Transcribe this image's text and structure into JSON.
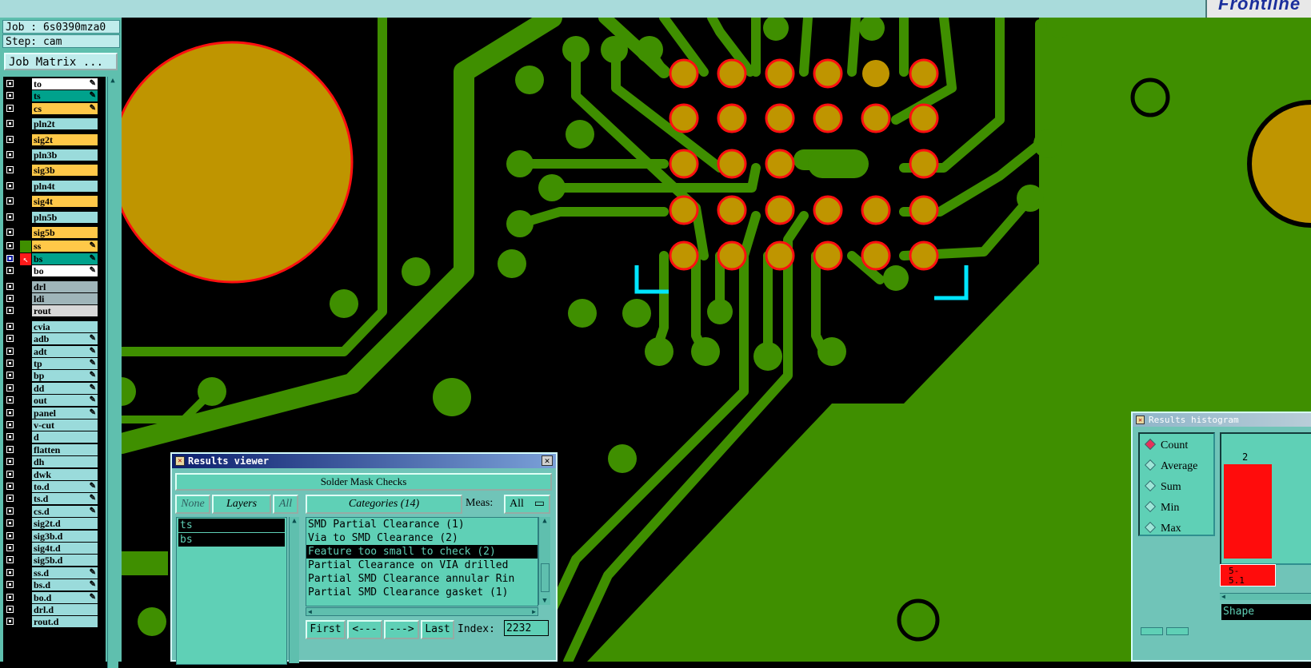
{
  "app": {
    "brand": "Frontline"
  },
  "job": {
    "job_label": "Job : 6s0390mza0",
    "step_label": "Step: cam",
    "matrix_button": "Job Matrix ..."
  },
  "layers": [
    {
      "name": "to",
      "color": "#ffffff",
      "flag": "✎"
    },
    {
      "name": "ts",
      "color": "#00a28c",
      "flag": "✎"
    },
    {
      "name": "cs",
      "color": "#ffc848",
      "flag": "✎"
    },
    {
      "name": "pln2t",
      "color": "#9adbdb",
      "flag": ""
    },
    {
      "name": "sig2t",
      "color": "#ffc848",
      "flag": ""
    },
    {
      "name": "pln3b",
      "color": "#9adbdb",
      "flag": ""
    },
    {
      "name": "sig3b",
      "color": "#ffc848",
      "flag": ""
    },
    {
      "name": "pln4t",
      "color": "#9adbdb",
      "flag": ""
    },
    {
      "name": "sig4t",
      "color": "#ffc848",
      "flag": ""
    },
    {
      "name": "pln5b",
      "color": "#9adbdb",
      "flag": ""
    },
    {
      "name": "sig5b",
      "color": "#ffc848",
      "flag": ""
    },
    {
      "name": "ss",
      "color": "#ffc848",
      "flag": "✎"
    },
    {
      "name": "bs",
      "color": "#00a28c",
      "flag": "✎"
    },
    {
      "name": "bo",
      "color": "#ffffff",
      "flag": "✎"
    },
    {
      "name": "drl",
      "color": "#9fb5b9",
      "flag": ""
    },
    {
      "name": "ldi",
      "color": "#9fb5b9",
      "flag": ""
    },
    {
      "name": "rout",
      "color": "#d8d8d8",
      "flag": ""
    },
    {
      "name": "cvia",
      "color": "#9adbdb",
      "flag": ""
    },
    {
      "name": "adb",
      "color": "#9adbdb",
      "flag": "✎"
    },
    {
      "name": "adt",
      "color": "#9adbdb",
      "flag": "✎"
    },
    {
      "name": "tp",
      "color": "#9adbdb",
      "flag": "✎"
    },
    {
      "name": "bp",
      "color": "#9adbdb",
      "flag": "✎"
    },
    {
      "name": "dd",
      "color": "#9adbdb",
      "flag": "✎"
    },
    {
      "name": "out",
      "color": "#9adbdb",
      "flag": "✎"
    },
    {
      "name": "panel",
      "color": "#9adbdb",
      "flag": "✎"
    },
    {
      "name": "v-cut",
      "color": "#9adbdb",
      "flag": ""
    },
    {
      "name": "d",
      "color": "#9adbdb",
      "flag": ""
    },
    {
      "name": "flatten",
      "color": "#9adbdb",
      "flag": ""
    },
    {
      "name": "dh",
      "color": "#9adbdb",
      "flag": ""
    },
    {
      "name": "dwk",
      "color": "#9adbdb",
      "flag": ""
    },
    {
      "name": "to.d",
      "color": "#9adbdb",
      "flag": "✎"
    },
    {
      "name": "ts.d",
      "color": "#9adbdb",
      "flag": "✎"
    },
    {
      "name": "cs.d",
      "color": "#9adbdb",
      "flag": "✎"
    },
    {
      "name": "sig2t.d",
      "color": "#9adbdb",
      "flag": ""
    },
    {
      "name": "sig3b.d",
      "color": "#9adbdb",
      "flag": ""
    },
    {
      "name": "sig4t.d",
      "color": "#9adbdb",
      "flag": ""
    },
    {
      "name": "sig5b.d",
      "color": "#9adbdb",
      "flag": ""
    },
    {
      "name": "ss.d",
      "color": "#9adbdb",
      "flag": "✎"
    },
    {
      "name": "bs.d",
      "color": "#9adbdb",
      "flag": "✎"
    },
    {
      "name": "bo.d",
      "color": "#9adbdb",
      "flag": "✎"
    },
    {
      "name": "drl.d",
      "color": "#9adbdb",
      "flag": ""
    },
    {
      "name": "rout.d",
      "color": "#9adbdb",
      "flag": ""
    }
  ],
  "results_viewer": {
    "title": "Results viewer",
    "heading": "Solder Mask Checks",
    "btn_none": "None",
    "btn_layers": "Layers",
    "btn_all": "All",
    "btn_categories": "Categories (14)",
    "meas_label": "Meas:",
    "meas_value": "All",
    "layer_list": [
      "ts",
      "bs"
    ],
    "categories": [
      "SMD Partial Clearance (1)",
      "Via to SMD Clearance (2)",
      "Feature too small to check (2)",
      "Partial Clearance on VIA drilled",
      "Partial SMD Clearance annular Rin",
      "Partial SMD Clearance gasket (1)"
    ],
    "selected_category_index": 2,
    "nav_first": "First",
    "nav_prev": "<---",
    "nav_next": "--->",
    "nav_last": "Last",
    "index_label": "Index:",
    "index_value": "2232"
  },
  "histogram": {
    "title": "Results histogram",
    "options": [
      "Count",
      "Average",
      "Sum",
      "Min",
      "Max"
    ],
    "selected": "Count",
    "bar_count": "2",
    "bin_label": "5-\n5.1",
    "shape_label": "Shape"
  },
  "colors": {
    "copper": "#3f8f00",
    "pad": "#bf9500",
    "pad_edge": "#ff1010",
    "marker": "#00e5ff"
  }
}
